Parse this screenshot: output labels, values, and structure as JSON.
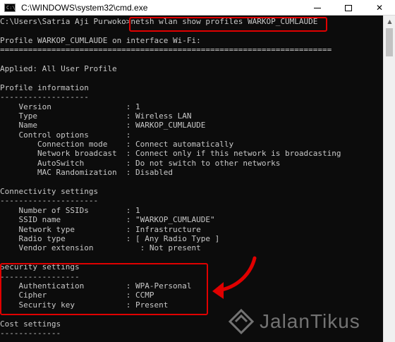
{
  "window": {
    "title": "C:\\WINDOWS\\system32\\cmd.exe",
    "icon": "cmd-app-icon",
    "icon_glyph": "C:\\",
    "controls": {
      "minimize": "minimize-icon",
      "maximize": "maximize-icon",
      "close": "close-icon",
      "close_glyph": "✕"
    }
  },
  "console": {
    "lines": [
      "C:\\Users\\Satria Aji Purwoko>netsh wlan show profiles WARKOP_CUMLAUDE",
      "",
      "Profile WARKOP_CUMLAUDE on interface Wi-Fi:",
      "=======================================================================",
      "",
      "Applied: All User Profile",
      "",
      "Profile information",
      "-------------------",
      "    Version                : 1",
      "    Type                   : Wireless LAN",
      "    Name                   : WARKOP_CUMLAUDE",
      "    Control options        :",
      "        Connection mode    : Connect automatically",
      "        Network broadcast  : Connect only if this network is broadcasting",
      "        AutoSwitch         : Do not switch to other networks",
      "        MAC Randomization  : Disabled",
      "",
      "Connectivity settings",
      "---------------------",
      "    Number of SSIDs        : 1",
      "    SSID name              : \"WARKOP_CUMLAUDE\"",
      "    Network type           : Infrastructure",
      "    Radio type             : [ Any Radio Type ]",
      "    Vendor extension          : Not present",
      "",
      "Security settings",
      "-----------------",
      "    Authentication         : WPA-Personal",
      "    Cipher                 : CCMP",
      "    Security key           : Present",
      "",
      "Cost settings",
      "-------------"
    ]
  },
  "scrollbar": {
    "up_glyph": "▲"
  },
  "annotation": {
    "color": "#e00000"
  },
  "watermark": {
    "text": "JalanTikus",
    "logo": "jalantikus-logo-icon"
  }
}
